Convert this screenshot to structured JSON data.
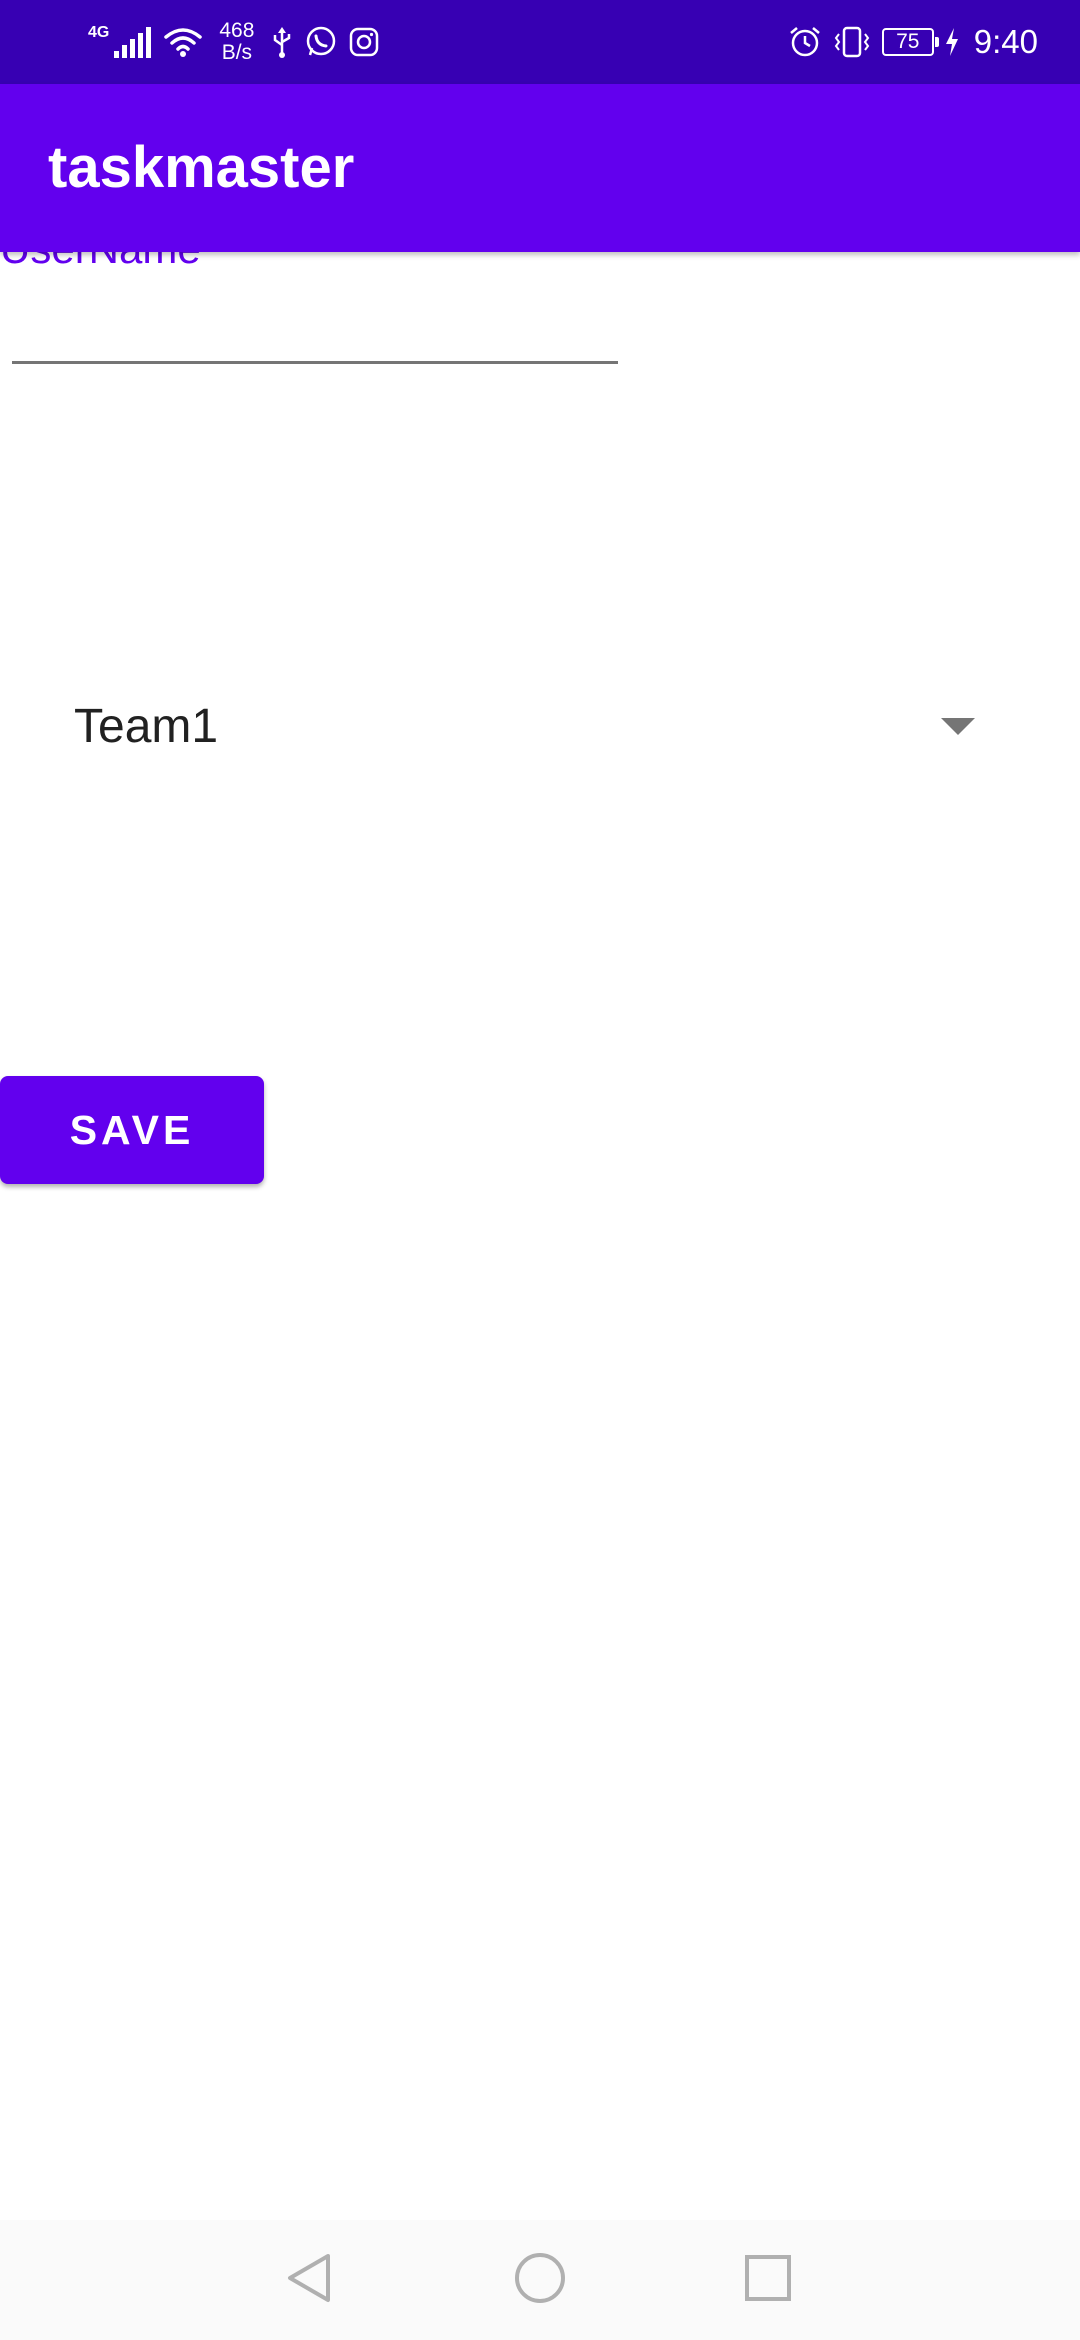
{
  "status_bar": {
    "network_type": "4G",
    "net_speed_value": "468",
    "net_speed_unit": "B/s",
    "battery_level": "75",
    "time": "9:40",
    "icons": [
      "signal-icon",
      "wifi-icon",
      "usb-icon",
      "whatsapp-icon",
      "instagram-icon",
      "alarm-icon",
      "vibrate-icon",
      "battery-icon",
      "charging-icon"
    ]
  },
  "app_bar": {
    "title": "taskmaster"
  },
  "form": {
    "input_label": "UserName",
    "input_value": "",
    "team_spinner_selected": "Team1",
    "save_label": "SAVE"
  },
  "nav_bar": {
    "icons": [
      "back-icon",
      "home-icon",
      "recents-icon"
    ]
  },
  "colors": {
    "status_bar": "#3700B3",
    "primary": "#6200EE",
    "background": "#FFFFFF"
  }
}
